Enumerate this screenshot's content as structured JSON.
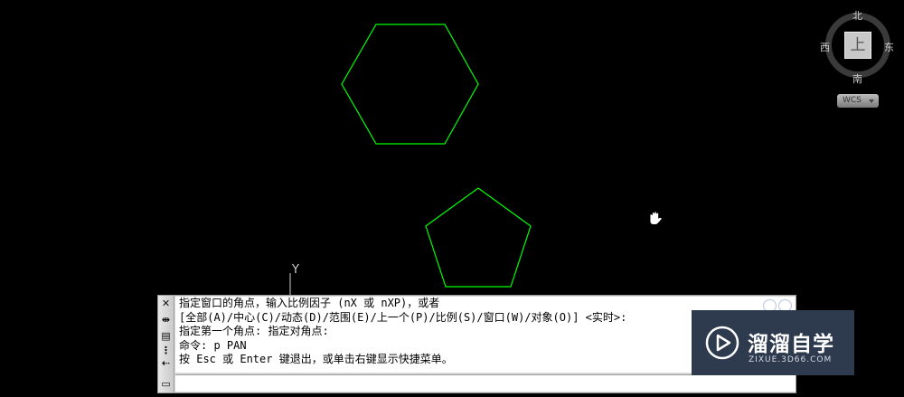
{
  "canvas": {
    "background": "#000000",
    "shape_color": "#00ff00",
    "ucs_axis_label": "Y"
  },
  "viewcube": {
    "north": "北",
    "south": "南",
    "west": "西",
    "east": "东",
    "face": "上",
    "wcs_label": "WCS"
  },
  "cursor": {
    "icon": "pan-hand-icon"
  },
  "command_window": {
    "lines": [
      "指定窗口的角点，输入比例因子 (nX 或 nXP)，或者",
      "[全部(A)/中心(C)/动态(D)/范围(E)/上一个(P)/比例(S)/窗口(W)/对象(O)] <实时>:",
      "指定第一个角点: 指定对角点:",
      "命令: p PAN",
      "按 Esc 或 Enter 键退出，或单击右键显示快捷菜单。"
    ],
    "input_value": "",
    "side_icons": [
      "close-icon",
      "resize-icon",
      "properties-icon",
      "options-icon",
      "history-icon"
    ]
  },
  "watermark": {
    "brand": "溜溜自学",
    "url": "ZIXUE.3D66.COM",
    "bg": "#2e3a4e"
  }
}
